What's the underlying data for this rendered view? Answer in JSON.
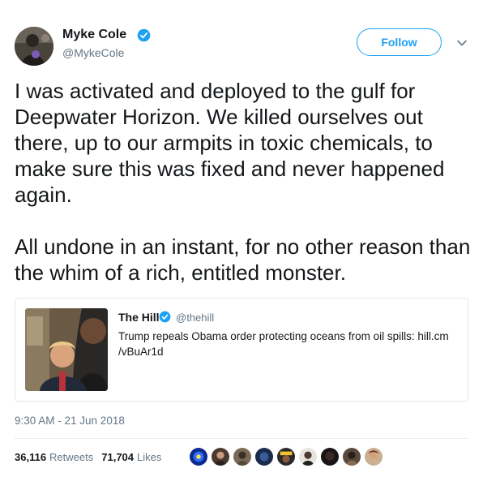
{
  "author": {
    "display_name": "Myke Cole",
    "handle": "@MykeCole",
    "verified": true
  },
  "follow_button": {
    "label": "Follow"
  },
  "tweet": {
    "text": "I was activated and deployed to the gulf for Deepwater Horizon. We killed ourselves out there, up to our armpits in toxic chemicals, to make sure this was fixed and never happened again.\n\nAll undone in an instant, for no other reason than the whim of a rich, entitled monster.",
    "timestamp": "9:30 AM - 21 Jun 2018"
  },
  "quoted_tweet": {
    "display_name": "The Hill",
    "handle": "@thehill",
    "verified": true,
    "text": "Trump repeals Obama order protecting oceans from oil spills: hill.cm /vBuAr1d"
  },
  "stats": {
    "retweets_count": "36,116",
    "retweets_label": "Retweets",
    "likes_count": "71,704",
    "likes_label": "Likes"
  },
  "colors": {
    "accent": "#1da1f2",
    "secondary_text": "#657786",
    "border": "#e1e8ed"
  },
  "icons": [
    "verified-badge-icon",
    "chevron-down-icon"
  ]
}
